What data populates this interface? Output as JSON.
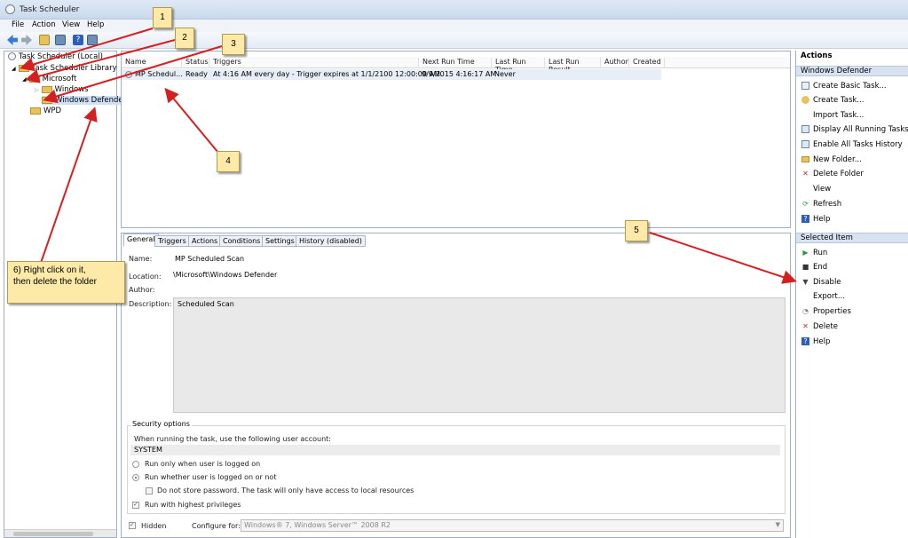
{
  "window": {
    "title": "Task Scheduler"
  },
  "menu": [
    "File",
    "Action",
    "View",
    "Help"
  ],
  "tree": {
    "root": "Task Scheduler (Local)",
    "library": "Task Scheduler Library",
    "microsoft": "Microsoft",
    "windows": "Windows",
    "defender": "Windows Defende",
    "wpd": "WPD"
  },
  "tasklist": {
    "columns": [
      "Name",
      "Status",
      "Triggers",
      "Next Run Time",
      "Last Run Time",
      "Last Run Result",
      "Author",
      "Created"
    ],
    "row": {
      "name": "MP Schedul...",
      "status": "Ready",
      "triggers": "At 4:16 AM every day - Trigger expires at 1/1/2100 12:00:00 AM.",
      "next_run": "9/9/2015 4:16:17 AM",
      "last_run": "Never"
    }
  },
  "detail": {
    "tabs": [
      "General",
      "Triggers",
      "Actions",
      "Conditions",
      "Settings",
      "History (disabled)"
    ],
    "name_label": "Name:",
    "name_value": "MP Scheduled Scan",
    "location_label": "Location:",
    "location_value": "\\Microsoft\\Windows Defender",
    "author_label": "Author:",
    "description_label": "Description:",
    "description_value": "Scheduled Scan",
    "security_title": "Security options",
    "account_prompt": "When running the task, use the following user account:",
    "account_value": "SYSTEM",
    "radio_logged_on": "Run only when user is logged on",
    "radio_whether": "Run whether user is logged on or not",
    "chk_nostore": "Do not store password.  The task will only have access to local resources",
    "chk_highest": "Run with highest privileges",
    "chk_hidden": "Hidden",
    "configure_label": "Configure for:",
    "configure_value": "Windows® 7, Windows Server™ 2008 R2"
  },
  "actions": {
    "title": "Actions",
    "section1": "Windows Defender",
    "items1": [
      "Create Basic Task...",
      "Create Task...",
      "Import Task...",
      "Display All Running Tasks",
      "Enable All Tasks History",
      "New Folder...",
      "Delete Folder",
      "View",
      "Refresh",
      "Help"
    ],
    "section2": "Selected Item",
    "items2": [
      "Run",
      "End",
      "Disable",
      "Export...",
      "Properties",
      "Delete",
      "Help"
    ]
  },
  "callouts": {
    "c1": "1",
    "c2": "2",
    "c3": "3",
    "c4": "4",
    "c5": "5",
    "c6_line1": "6) Right click on it,",
    "c6_line2": "then delete the folder"
  },
  "colors": {
    "callout_bg": "#fdeaa8",
    "arrow": "#d42020",
    "section_bg": "#d7e3f1"
  }
}
